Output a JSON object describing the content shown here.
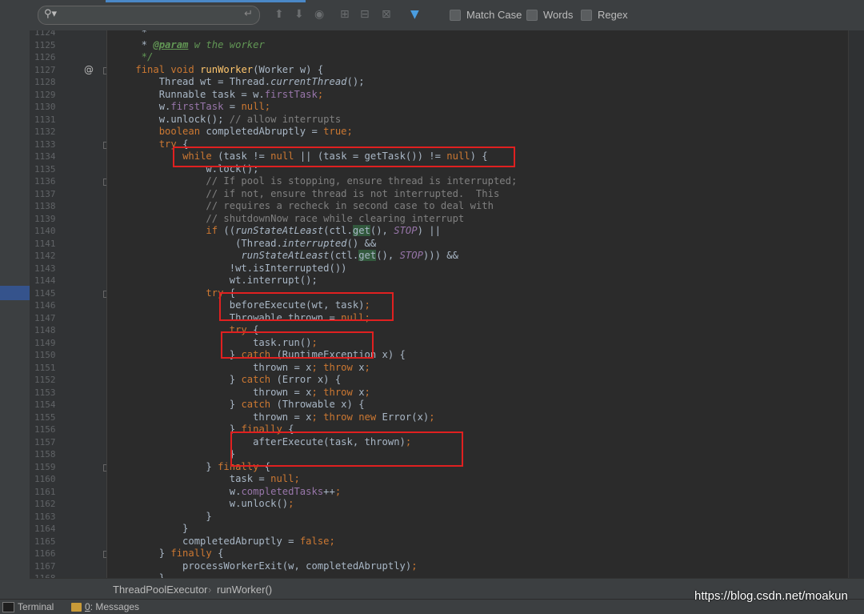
{
  "search": {
    "match_case": "Match Case",
    "words": "Words",
    "regex": "Regex",
    "icons": [
      "search-icon",
      "enter-icon",
      "previous-occurrence-icon",
      "next-occurrence-icon",
      "find-all-icon",
      "add-selection-icon",
      "remove-selection-icon",
      "select-all-icon",
      "filter-icon"
    ]
  },
  "gutter": {
    "line_numbers": [
      "1124",
      "1125",
      "1126",
      "1127",
      "1128",
      "1129",
      "1130",
      "1131",
      "1132",
      "1133",
      "1134",
      "1135",
      "1136",
      "1137",
      "1138",
      "1139",
      "1140",
      "1141",
      "1142",
      "1143",
      "1144",
      "1145",
      "1146",
      "1147",
      "1148",
      "1149",
      "1150",
      "1151",
      "1152",
      "1153",
      "1154",
      "1155",
      "1156",
      "1157",
      "1158",
      "1159",
      "1160",
      "1161",
      "1162",
      "1163",
      "1164",
      "1165",
      "1166",
      "1167",
      "1168"
    ],
    "override_marker": "@"
  },
  "code": [
    [
      [
        "     *",
        ""
      ]
    ],
    [
      [
        "     * ",
        ""
      ],
      [
        "@param",
        "tag"
      ],
      [
        " w the worker",
        "doc"
      ]
    ],
    [
      [
        "     */",
        "doc"
      ]
    ],
    [
      [
        "    ",
        ""
      ],
      [
        "final void ",
        "k"
      ],
      [
        "runWorker",
        "fn"
      ],
      [
        "(Worker w) {",
        ""
      ]
    ],
    [
      [
        "        Thread wt = Thread.",
        ""
      ],
      [
        "currentThread",
        "it"
      ],
      [
        "();",
        ""
      ]
    ],
    [
      [
        "        Runnable task = w.",
        ""
      ],
      [
        "firstTask",
        "fld"
      ],
      [
        "k_semicolon",
        ""
      ]
    ],
    [
      [
        "        w.",
        ""
      ],
      [
        "firstTask",
        "fld"
      ],
      [
        " = ",
        ""
      ],
      [
        "null",
        "k"
      ],
      [
        ";",
        "k"
      ]
    ],
    [
      [
        "        w.unlock(); ",
        ""
      ],
      [
        "// allow interrupts",
        "cm"
      ]
    ],
    [
      [
        "        ",
        ""
      ],
      [
        "boolean ",
        "k"
      ],
      [
        "completedAbruptly = ",
        ""
      ],
      [
        "true",
        "k"
      ],
      [
        ";",
        "k"
      ]
    ],
    [
      [
        "        ",
        ""
      ],
      [
        "try ",
        "k"
      ],
      [
        "{",
        ""
      ]
    ],
    [
      [
        "            ",
        ""
      ],
      [
        "while ",
        "k"
      ],
      [
        "(task != ",
        ""
      ],
      [
        "null ",
        "k"
      ],
      [
        "|| (task = getTask()) != ",
        ""
      ],
      [
        "null",
        "k"
      ],
      [
        ") {",
        ""
      ]
    ],
    [
      [
        "                w.lock();",
        ""
      ]
    ],
    [
      [
        "                ",
        ""
      ],
      [
        "// If pool is stopping, ensure thread is interrupted;",
        "cm"
      ]
    ],
    [
      [
        "                ",
        ""
      ],
      [
        "// if not, ensure thread is not interrupted.  This",
        "cm"
      ]
    ],
    [
      [
        "                ",
        ""
      ],
      [
        "// requires a recheck in second case to deal with",
        "cm"
      ]
    ],
    [
      [
        "                ",
        ""
      ],
      [
        "// shutdownNow race while clearing interrupt",
        "cm"
      ]
    ],
    [
      [
        "                ",
        ""
      ],
      [
        "if ",
        "k"
      ],
      [
        "((",
        ""
      ],
      [
        "runStateAtLeast",
        "it"
      ],
      [
        "(ctl.",
        ""
      ],
      [
        "get",
        "hl"
      ],
      [
        "(), ",
        ""
      ],
      [
        "STOP",
        "cst"
      ],
      [
        ") ||",
        ""
      ]
    ],
    [
      [
        "                     (Thread.",
        ""
      ],
      [
        "interrupted",
        "it"
      ],
      [
        "() &&",
        ""
      ]
    ],
    [
      [
        "                      ",
        ""
      ],
      [
        "runStateAtLeast",
        "it"
      ],
      [
        "(ctl.",
        ""
      ],
      [
        "get",
        "hl"
      ],
      [
        "(), ",
        ""
      ],
      [
        "STOP",
        "cst"
      ],
      [
        "))) &&",
        ""
      ]
    ],
    [
      [
        "                    !wt.isInterrupted())",
        ""
      ]
    ],
    [
      [
        "                    wt.interrupt();",
        ""
      ]
    ],
    [
      [
        "                ",
        ""
      ],
      [
        "try ",
        "k"
      ],
      [
        "{",
        ""
      ]
    ],
    [
      [
        "                    beforeExecute(wt, task)",
        ""
      ],
      [
        ";",
        "k"
      ]
    ],
    [
      [
        "                    Throwable thrown = ",
        ""
      ],
      [
        "null",
        "k"
      ],
      [
        ";",
        "k"
      ]
    ],
    [
      [
        "                    ",
        ""
      ],
      [
        "try ",
        "k"
      ],
      [
        "{",
        ""
      ]
    ],
    [
      [
        "                        task.run()",
        ""
      ],
      [
        ";",
        "k"
      ]
    ],
    [
      [
        "                    } ",
        ""
      ],
      [
        "catch ",
        "k"
      ],
      [
        "(RuntimeException x) {",
        ""
      ]
    ],
    [
      [
        "                        thrown = x",
        ""
      ],
      [
        "; ",
        "k"
      ],
      [
        "throw ",
        "k"
      ],
      [
        "x",
        ""
      ],
      [
        ";",
        "k"
      ]
    ],
    [
      [
        "                    } ",
        ""
      ],
      [
        "catch ",
        "k"
      ],
      [
        "(Error x) {",
        ""
      ]
    ],
    [
      [
        "                        thrown = x",
        ""
      ],
      [
        "; ",
        "k"
      ],
      [
        "throw ",
        "k"
      ],
      [
        "x",
        ""
      ],
      [
        ";",
        "k"
      ]
    ],
    [
      [
        "                    } ",
        ""
      ],
      [
        "catch ",
        "k"
      ],
      [
        "(Throwable x) {",
        ""
      ]
    ],
    [
      [
        "                        thrown = x",
        ""
      ],
      [
        "; ",
        "k"
      ],
      [
        "throw new ",
        "k"
      ],
      [
        "Error(x)",
        ""
      ],
      [
        ";",
        "k"
      ]
    ],
    [
      [
        "                    } ",
        ""
      ],
      [
        "finally ",
        "k"
      ],
      [
        "{",
        ""
      ]
    ],
    [
      [
        "                        afterExecute(task, thrown)",
        ""
      ],
      [
        ";",
        "k"
      ]
    ],
    [
      [
        "                    }",
        ""
      ]
    ],
    [
      [
        "                } ",
        ""
      ],
      [
        "finally ",
        "k"
      ],
      [
        "{",
        ""
      ]
    ],
    [
      [
        "                    task = ",
        ""
      ],
      [
        "null",
        "k"
      ],
      [
        ";",
        "k"
      ]
    ],
    [
      [
        "                    w.",
        ""
      ],
      [
        "completedTasks",
        "fld"
      ],
      [
        "++",
        ""
      ],
      [
        ";",
        "k"
      ]
    ],
    [
      [
        "                    w.unlock()",
        ""
      ],
      [
        ";",
        "k"
      ]
    ],
    [
      [
        "                }",
        ""
      ]
    ],
    [
      [
        "            }",
        ""
      ]
    ],
    [
      [
        "            completedAbruptly = ",
        ""
      ],
      [
        "false",
        "k"
      ],
      [
        ";",
        "k"
      ]
    ],
    [
      [
        "        } ",
        ""
      ],
      [
        "finally ",
        "k"
      ],
      [
        "{",
        ""
      ]
    ],
    [
      [
        "            processWorkerExit(w, completedAbruptly)",
        ""
      ],
      [
        ";",
        "k"
      ]
    ],
    [
      [
        "        }",
        ""
      ]
    ]
  ],
  "breadcrumb": {
    "class_name": "ThreadPoolExecutor",
    "method_name": "runWorker()"
  },
  "bottom": {
    "terminal": "Terminal",
    "messages_index": "0",
    "messages_label": ": Messages"
  },
  "watermark": "https://blog.csdn.net/moakun",
  "colors": {
    "background": "#2b2b2b",
    "keyword": "#cc7832",
    "comment": "#808080",
    "highlight_box": "#e02020"
  }
}
